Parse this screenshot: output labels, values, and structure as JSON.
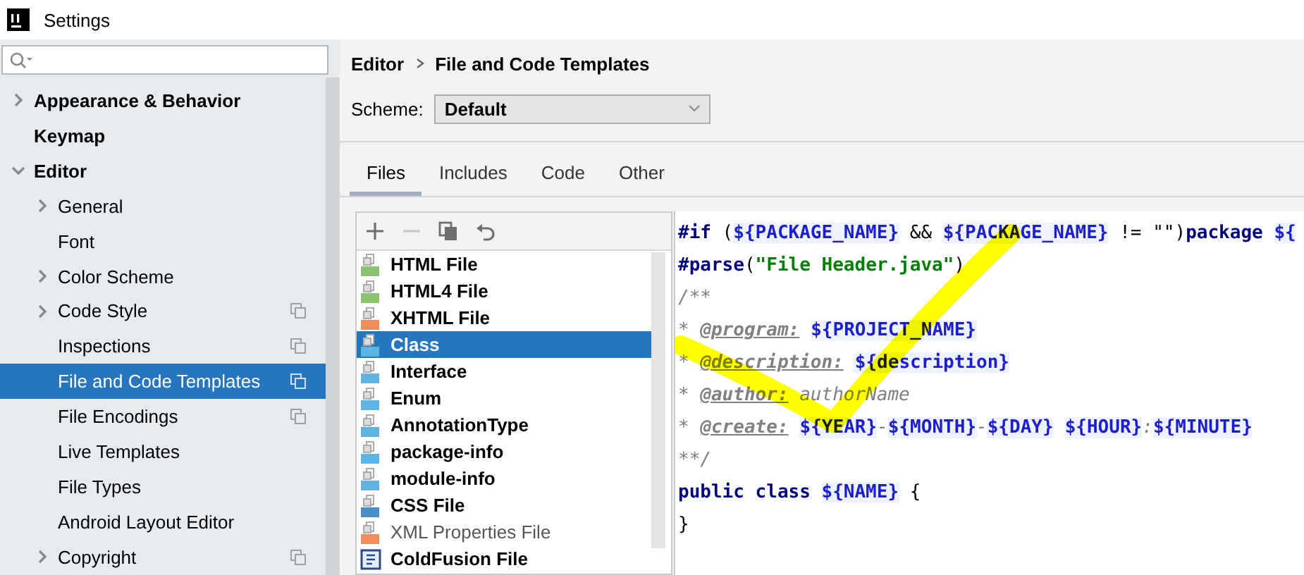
{
  "window": {
    "title": "Settings"
  },
  "sidebar": {
    "items": [
      {
        "label": "Appearance & Behavior",
        "expandable": true,
        "expanded": false,
        "selected": false,
        "project_level": false
      },
      {
        "label": "Keymap",
        "expandable": false,
        "selected": false,
        "project_level": false
      },
      {
        "label": "Editor",
        "expandable": true,
        "expanded": true,
        "selected": false,
        "project_level": false,
        "children": [
          {
            "label": "General",
            "expandable": true,
            "expanded": false,
            "selected": false,
            "project_level": false
          },
          {
            "label": "Font",
            "expandable": false,
            "selected": false,
            "project_level": false
          },
          {
            "label": "Color Scheme",
            "expandable": true,
            "expanded": false,
            "selected": false,
            "project_level": false
          },
          {
            "label": "Code Style",
            "expandable": true,
            "expanded": false,
            "selected": false,
            "project_level": true
          },
          {
            "label": "Inspections",
            "expandable": false,
            "selected": false,
            "project_level": true
          },
          {
            "label": "File and Code Templates",
            "expandable": false,
            "selected": true,
            "project_level": true
          },
          {
            "label": "File Encodings",
            "expandable": false,
            "selected": false,
            "project_level": true
          },
          {
            "label": "Live Templates",
            "expandable": false,
            "selected": false,
            "project_level": false
          },
          {
            "label": "File Types",
            "expandable": false,
            "selected": false,
            "project_level": false
          },
          {
            "label": "Android Layout Editor",
            "expandable": false,
            "selected": false,
            "project_level": false
          },
          {
            "label": "Copyright",
            "expandable": true,
            "expanded": false,
            "selected": false,
            "project_level": true
          }
        ]
      }
    ]
  },
  "breadcrumb": [
    "Editor",
    "File and Code Templates"
  ],
  "scheme": {
    "label": "Scheme:",
    "value": "Default"
  },
  "tabs": [
    {
      "label": "Files",
      "selected": true
    },
    {
      "label": "Includes",
      "selected": false
    },
    {
      "label": "Code",
      "selected": false
    },
    {
      "label": "Other",
      "selected": false
    }
  ],
  "toolbar": [
    {
      "kind": "add",
      "disabled": false
    },
    {
      "kind": "remove",
      "disabled": true
    },
    {
      "kind": "copy",
      "disabled": false
    },
    {
      "kind": "reset",
      "disabled": false
    }
  ],
  "templates": [
    {
      "label": "HTML File",
      "kind": "file",
      "color": "#8bc270",
      "bold": true,
      "selected": false
    },
    {
      "label": "HTML4 File",
      "kind": "file",
      "color": "#8bc270",
      "bold": true,
      "selected": false
    },
    {
      "label": "XHTML File",
      "kind": "file",
      "color": "#f28c5a",
      "bold": true,
      "selected": false
    },
    {
      "label": "Class",
      "kind": "file",
      "color": "#5fb3e0",
      "bold": true,
      "selected": true
    },
    {
      "label": "Interface",
      "kind": "file",
      "color": "#5fb3e0",
      "bold": true,
      "selected": false
    },
    {
      "label": "Enum",
      "kind": "file",
      "color": "#5fb3e0",
      "bold": true,
      "selected": false
    },
    {
      "label": "AnnotationType",
      "kind": "file",
      "color": "#5fb3e0",
      "bold": true,
      "selected": false
    },
    {
      "label": "package-info",
      "kind": "file",
      "color": "#5fb3e0",
      "bold": true,
      "selected": false
    },
    {
      "label": "module-info",
      "kind": "file",
      "color": "#5fb3e0",
      "bold": true,
      "selected": false
    },
    {
      "label": "CSS File",
      "kind": "file",
      "color": "#4a90c8",
      "bold": true,
      "selected": false
    },
    {
      "label": "XML Properties File",
      "kind": "file",
      "color": "#f28c5a",
      "bold": false,
      "selected": false
    },
    {
      "label": "ColdFusion File",
      "kind": "badge",
      "color": "#2b4a8c",
      "bold": true,
      "selected": false
    }
  ],
  "editor": {
    "lines": [
      [
        {
          "text": "#if",
          "kind": "keyword"
        },
        {
          "text": " (",
          "kind": "plain"
        },
        {
          "text": "${PACKAGE_NAME}",
          "kind": "var"
        },
        {
          "text": " && ",
          "kind": "plain"
        },
        {
          "text": "${PACKAGE_NAME}",
          "kind": "var"
        },
        {
          "text": " != ",
          "kind": "plain"
        },
        {
          "text": "\"\"",
          "kind": "plain"
        },
        {
          "text": ")",
          "kind": "plain"
        },
        {
          "text": "package ",
          "kind": "keyword"
        },
        {
          "text": "${",
          "kind": "var"
        }
      ],
      [
        {
          "text": "#parse",
          "kind": "keyword"
        },
        {
          "text": "(",
          "kind": "plain"
        },
        {
          "text": "\"File Header.java\"",
          "kind": "string"
        },
        {
          "text": ")",
          "kind": "plain"
        }
      ],
      [
        {
          "text": "/**",
          "kind": "comment"
        }
      ],
      [
        {
          "text": "* ",
          "kind": "comment"
        },
        {
          "text": "@program:",
          "kind": "tag"
        },
        {
          "text": "${PROJECT_NAME}",
          "kind": "var",
          "gap": true
        }
      ],
      [
        {
          "text": "* ",
          "kind": "comment"
        },
        {
          "text": "@description:",
          "kind": "tag"
        },
        {
          "text": "${description}",
          "kind": "var",
          "gap": true
        }
      ],
      [
        {
          "text": "* ",
          "kind": "comment"
        },
        {
          "text": "@author:",
          "kind": "tag"
        },
        {
          "text": " authorName",
          "kind": "comment"
        }
      ],
      [
        {
          "text": "* ",
          "kind": "comment"
        },
        {
          "text": "@create:",
          "kind": "tag"
        },
        {
          "text": "${YEAR}",
          "kind": "var",
          "gap": true
        },
        {
          "text": "-",
          "kind": "comment"
        },
        {
          "text": "${MONTH}",
          "kind": "var"
        },
        {
          "text": "-",
          "kind": "comment"
        },
        {
          "text": "${DAY}",
          "kind": "var"
        },
        {
          "text": "${HOUR}",
          "kind": "var",
          "gap": true
        },
        {
          "text": ":",
          "kind": "comment"
        },
        {
          "text": "${MINUTE}",
          "kind": "var"
        }
      ],
      [
        {
          "text": "**/",
          "kind": "comment"
        }
      ],
      [
        {
          "text": "public class ",
          "kind": "keyword"
        },
        {
          "text": "${NAME}",
          "kind": "var"
        },
        {
          "text": " {",
          "kind": "plain"
        }
      ],
      [
        {
          "text": "}",
          "kind": "plain"
        }
      ]
    ]
  }
}
